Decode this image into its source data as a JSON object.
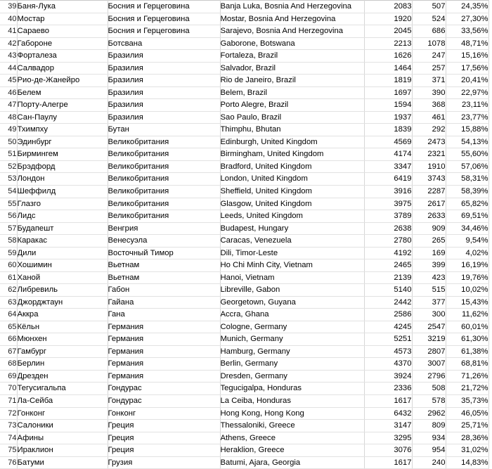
{
  "table": {
    "columns": [
      "row_number",
      "city_ru",
      "country_ru",
      "location_en",
      "total",
      "count",
      "percent"
    ],
    "rows": [
      {
        "n": "39",
        "city": "Баня-Лука",
        "country": "Босния и Герцеговина",
        "label": "Banja Luka, Bosnia And Herzegovina",
        "total": "2083",
        "count": "507",
        "pct": "24,35%"
      },
      {
        "n": "40",
        "city": "Мостар",
        "country": "Босния и Герцеговина",
        "label": "Mostar, Bosnia And Herzegovina",
        "total": "1920",
        "count": "524",
        "pct": "27,30%"
      },
      {
        "n": "41",
        "city": "Сараево",
        "country": "Босния и Герцеговина",
        "label": "Sarajevo, Bosnia And Herzegovina",
        "total": "2045",
        "count": "686",
        "pct": "33,56%"
      },
      {
        "n": "42",
        "city": "Габороне",
        "country": "Ботсвана",
        "label": "Gaborone, Botswana",
        "total": "2213",
        "count": "1078",
        "pct": "48,71%"
      },
      {
        "n": "43",
        "city": "Форталеза",
        "country": "Бразилия",
        "label": "Fortaleza, Brazil",
        "total": "1626",
        "count": "247",
        "pct": "15,16%"
      },
      {
        "n": "44",
        "city": "Салвадор",
        "country": "Бразилия",
        "label": "Salvador, Brazil",
        "total": "1464",
        "count": "257",
        "pct": "17,56%"
      },
      {
        "n": "45",
        "city": "Рио-де-Жанейро",
        "country": "Бразилия",
        "label": "Rio de Janeiro, Brazil",
        "total": "1819",
        "count": "371",
        "pct": "20,41%"
      },
      {
        "n": "46",
        "city": "Белем",
        "country": "Бразилия",
        "label": "Belem, Brazil",
        "total": "1697",
        "count": "390",
        "pct": "22,97%"
      },
      {
        "n": "47",
        "city": "Порту-Алегре",
        "country": "Бразилия",
        "label": "Porto Alegre, Brazil",
        "total": "1594",
        "count": "368",
        "pct": "23,11%"
      },
      {
        "n": "48",
        "city": "Сан-Паулу",
        "country": "Бразилия",
        "label": "Sao Paulo, Brazil",
        "total": "1937",
        "count": "461",
        "pct": "23,77%"
      },
      {
        "n": "49",
        "city": "Тхимпху",
        "country": "Бутан",
        "label": "Thimphu, Bhutan",
        "total": "1839",
        "count": "292",
        "pct": "15,88%"
      },
      {
        "n": "50",
        "city": "Эдинбург",
        "country": "Великобритания",
        "label": "Edinburgh, United Kingdom",
        "total": "4569",
        "count": "2473",
        "pct": "54,13%"
      },
      {
        "n": "51",
        "city": "Бирмингем",
        "country": "Великобритания",
        "label": "Birmingham, United Kingdom",
        "total": "4174",
        "count": "2321",
        "pct": "55,60%"
      },
      {
        "n": "52",
        "city": "Брэдфорд",
        "country": "Великобритания",
        "label": "Bradford, United Kingdom",
        "total": "3347",
        "count": "1910",
        "pct": "57,06%"
      },
      {
        "n": "53",
        "city": "Лондон",
        "country": "Великобритания",
        "label": "London, United Kingdom",
        "total": "6419",
        "count": "3743",
        "pct": "58,31%"
      },
      {
        "n": "54",
        "city": "Шеффилд",
        "country": "Великобритания",
        "label": "Sheffield, United Kingdom",
        "total": "3916",
        "count": "2287",
        "pct": "58,39%"
      },
      {
        "n": "55",
        "city": "Глазго",
        "country": "Великобритания",
        "label": "Glasgow, United Kingdom",
        "total": "3975",
        "count": "2617",
        "pct": "65,82%"
      },
      {
        "n": "56",
        "city": "Лидс",
        "country": "Великобритания",
        "label": "Leeds, United Kingdom",
        "total": "3789",
        "count": "2633",
        "pct": "69,51%"
      },
      {
        "n": "57",
        "city": "Будапешт",
        "country": "Венгрия",
        "label": "Budapest, Hungary",
        "total": "2638",
        "count": "909",
        "pct": "34,46%"
      },
      {
        "n": "58",
        "city": "Каракас",
        "country": "Венесуэла",
        "label": "Caracas, Venezuela",
        "total": "2780",
        "count": "265",
        "pct": "9,54%"
      },
      {
        "n": "59",
        "city": "Дили",
        "country": "Восточный Тимор",
        "label": "Dili, Timor-Leste",
        "total": "4192",
        "count": "169",
        "pct": "4,02%"
      },
      {
        "n": "60",
        "city": "Хошимин",
        "country": "Вьетнам",
        "label": "Ho Chi Minh City, Vietnam",
        "total": "2465",
        "count": "399",
        "pct": "16,19%"
      },
      {
        "n": "61",
        "city": "Ханой",
        "country": "Вьетнам",
        "label": "Hanoi, Vietnam",
        "total": "2139",
        "count": "423",
        "pct": "19,76%"
      },
      {
        "n": "62",
        "city": "Либревиль",
        "country": "Габон",
        "label": "Libreville, Gabon",
        "total": "5140",
        "count": "515",
        "pct": "10,02%"
      },
      {
        "n": "63",
        "city": "Джорджтаун",
        "country": "Гайана",
        "label": "Georgetown, Guyana",
        "total": "2442",
        "count": "377",
        "pct": "15,43%"
      },
      {
        "n": "64",
        "city": "Аккра",
        "country": "Гана",
        "label": "Accra, Ghana",
        "total": "2586",
        "count": "300",
        "pct": "11,62%"
      },
      {
        "n": "65",
        "city": "Кёльн",
        "country": "Германия",
        "label": "Cologne, Germany",
        "total": "4245",
        "count": "2547",
        "pct": "60,01%"
      },
      {
        "n": "66",
        "city": "Мюнхен",
        "country": "Германия",
        "label": "Munich, Germany",
        "total": "5251",
        "count": "3219",
        "pct": "61,30%"
      },
      {
        "n": "67",
        "city": "Гамбург",
        "country": "Германия",
        "label": "Hamburg, Germany",
        "total": "4573",
        "count": "2807",
        "pct": "61,38%"
      },
      {
        "n": "68",
        "city": "Берлин",
        "country": "Германия",
        "label": "Berlin, Germany",
        "total": "4370",
        "count": "3007",
        "pct": "68,81%"
      },
      {
        "n": "69",
        "city": "Дрезден",
        "country": "Германия",
        "label": "Dresden, Germany",
        "total": "3924",
        "count": "2796",
        "pct": "71,26%"
      },
      {
        "n": "70",
        "city": "Тегусигальпа",
        "country": "Гондурас",
        "label": "Tegucigalpa, Honduras",
        "total": "2336",
        "count": "508",
        "pct": "21,72%"
      },
      {
        "n": "71",
        "city": "Ла-Сейба",
        "country": "Гондурас",
        "label": "La Ceiba, Honduras",
        "total": "1617",
        "count": "578",
        "pct": "35,73%"
      },
      {
        "n": "72",
        "city": "Гонконг",
        "country": "Гонконг",
        "label": "Hong Kong, Hong Kong",
        "total": "6432",
        "count": "2962",
        "pct": "46,05%"
      },
      {
        "n": "73",
        "city": "Салоники",
        "country": "Греция",
        "label": "Thessaloniki, Greece",
        "total": "3147",
        "count": "809",
        "pct": "25,71%"
      },
      {
        "n": "74",
        "city": "Афины",
        "country": "Греция",
        "label": "Athens, Greece",
        "total": "3295",
        "count": "934",
        "pct": "28,36%"
      },
      {
        "n": "75",
        "city": "Ираклион",
        "country": "Греция",
        "label": "Heraklion, Greece",
        "total": "3076",
        "count": "954",
        "pct": "31,02%"
      },
      {
        "n": "76",
        "city": "Батуми",
        "country": "Грузия",
        "label": "Batumi, Ajara, Georgia",
        "total": "1617",
        "count": "240",
        "pct": "14,83%"
      }
    ]
  }
}
